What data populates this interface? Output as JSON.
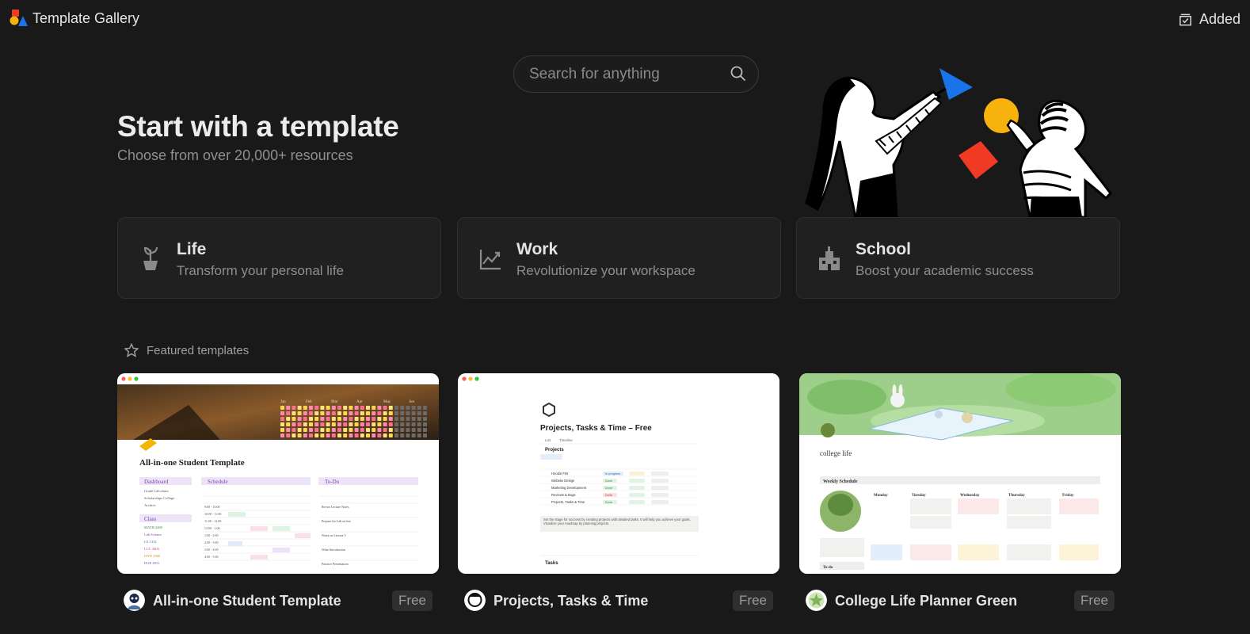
{
  "app": {
    "title": "Template Gallery"
  },
  "header": {
    "added_label": "Added"
  },
  "search": {
    "placeholder": "Search for anything"
  },
  "hero": {
    "title": "Start with a template",
    "subtitle": "Choose from over 20,000+ resources"
  },
  "categories": [
    {
      "title": "Life",
      "description": "Transform your personal life",
      "icon": "plant-pot-icon"
    },
    {
      "title": "Work",
      "description": "Revolutionize your workspace",
      "icon": "line-chart-icon"
    },
    {
      "title": "School",
      "description": "Boost your academic success",
      "icon": "school-building-icon"
    }
  ],
  "featured": {
    "label": "Featured templates",
    "icon": "star-icon",
    "templates": [
      {
        "name": "All-in-one Student Template",
        "price": "Free",
        "preview": {
          "heading": "All-in-one Student Template",
          "months": [
            "Jan",
            "Feb",
            "Mar",
            "Apr",
            "May",
            "Jun"
          ],
          "sections": [
            "Dashboard",
            "Schedule",
            "To-Do"
          ],
          "sidebar_items": [
            "Grade Calculator",
            "Scholarships Collage ...",
            "Archive"
          ],
          "class_label": "Class",
          "class_items": [
            "MATH 2469",
            "Lab Science",
            "CS 1332",
            "LCC 3403",
            "ISYE 3360",
            "DGE 2011"
          ],
          "schedule_times": [
            "9:00 - 10:00",
            "10:00 - 11:00",
            "11:00 - 12:00",
            "12:00 - 1:00",
            "1:00 - 2:00",
            "2:00 - 3:00",
            "3:00 - 4:00",
            "4:00 - 5:00"
          ],
          "todo_items": [
            "Revise Lecture Notes",
            "Prepare for Lab on test",
            "Notes on Lecture 3",
            "Write Introduction",
            "Practice Presentation"
          ]
        }
      },
      {
        "name": "Projects, Tasks & Time",
        "price": "Free",
        "preview": {
          "heading": "Projects, Tasks & Time – Free",
          "tabs": [
            "List",
            "Timeline"
          ],
          "section": "Projects",
          "rows": [
            "Hoodie Fits",
            "Website Design",
            "Marketing Development",
            "Reviews & Bugs",
            "Projects, Tasks & Time"
          ],
          "statuses": [
            "In progress",
            "Done",
            "Done",
            "Delta",
            "Done"
          ],
          "note": "Set the stage for success by creating projects with detailed tasks. It will help you achieve your goals. Visualize your roadmap by planning projects.",
          "tasks_label": "Tasks"
        }
      },
      {
        "name": "College Life Planner Green",
        "price": "Free",
        "preview": {
          "heading": "college life",
          "schedule_label": "Weekly Schedule",
          "days": [
            "Monday",
            "Tuesday",
            "Wednesday",
            "Thursday",
            "Friday"
          ],
          "todo_label": "To-do"
        }
      }
    ]
  },
  "colors": {
    "background": "#191919",
    "card": "#202020",
    "accent_blue": "#1a73e8",
    "accent_yellow": "#f7b20d",
    "accent_red": "#f03a23"
  }
}
